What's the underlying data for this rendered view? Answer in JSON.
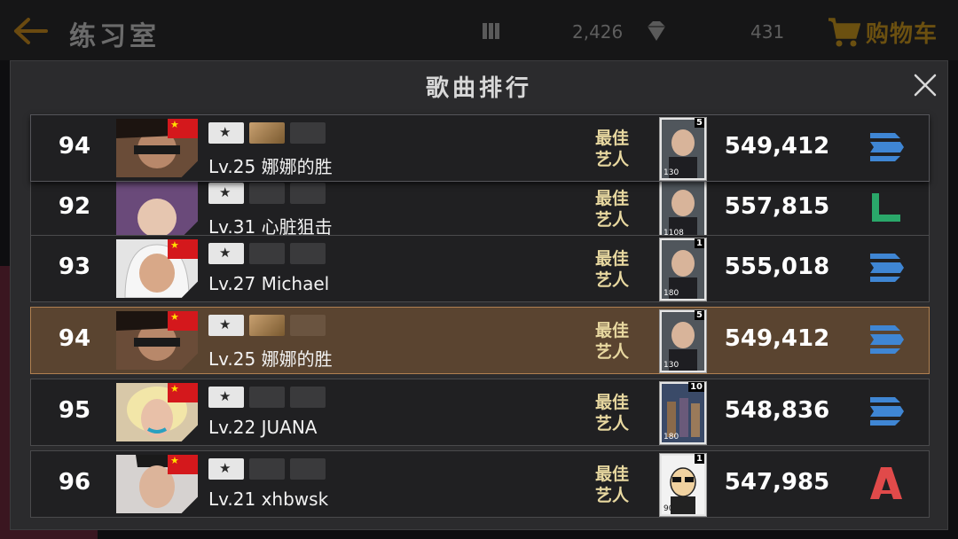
{
  "topbar": {
    "title": "练习室",
    "stat1_value": "2,426",
    "stat2_value": "431",
    "cart_label": "购物车"
  },
  "modal": {
    "title": "歌曲排行"
  },
  "rows": [
    {
      "rank": "94",
      "lv": "Lv.25",
      "name": "娜娜的胜",
      "best_artist_line1": "最佳",
      "best_artist_line2": "艺人",
      "card_level": "5",
      "card_power": "130",
      "score": "549,412",
      "grade_icon": "grade-bars-icon",
      "grade_color": "#3f86d4",
      "flag": "china-flag",
      "badge2_gold": true
    },
    {
      "rank": "92",
      "lv": "Lv.31",
      "name": "心脏狙击",
      "best_artist_line1": "最佳",
      "best_artist_line2": "艺人",
      "card_level": "",
      "card_power": "1108",
      "score": "557,815",
      "grade_icon": "grade-c-icon",
      "grade_color": "#2aa86a",
      "flag": "",
      "badge2_gold": false
    },
    {
      "rank": "93",
      "lv": "Lv.27",
      "name": "Michael",
      "best_artist_line1": "最佳",
      "best_artist_line2": "艺人",
      "card_level": "1",
      "card_power": "180",
      "score": "555,018",
      "grade_icon": "grade-bars-icon",
      "grade_color": "#3f86d4",
      "flag": "china-flag",
      "badge2_gold": false
    },
    {
      "rank": "94",
      "lv": "Lv.25",
      "name": "娜娜的胜",
      "best_artist_line1": "最佳",
      "best_artist_line2": "艺人",
      "card_level": "5",
      "card_power": "130",
      "score": "549,412",
      "grade_icon": "grade-bars-icon",
      "grade_color": "#3f86d4",
      "flag": "china-flag",
      "badge2_gold": true
    },
    {
      "rank": "95",
      "lv": "Lv.22",
      "name": "JUANA",
      "best_artist_line1": "最佳",
      "best_artist_line2": "艺人",
      "card_level": "10",
      "card_power": "180",
      "score": "548,836",
      "grade_icon": "grade-bars-icon",
      "grade_color": "#3f86d4",
      "flag": "china-flag",
      "badge2_gold": false
    },
    {
      "rank": "96",
      "lv": "Lv.21",
      "name": "xhbwsk",
      "best_artist_line1": "最佳",
      "best_artist_line2": "艺人",
      "card_level": "1",
      "card_power": "90",
      "score": "547,985",
      "grade_icon": "grade-a-icon",
      "grade_color": "#e04a4a",
      "flag": "china-flag",
      "badge2_gold": false
    }
  ]
}
